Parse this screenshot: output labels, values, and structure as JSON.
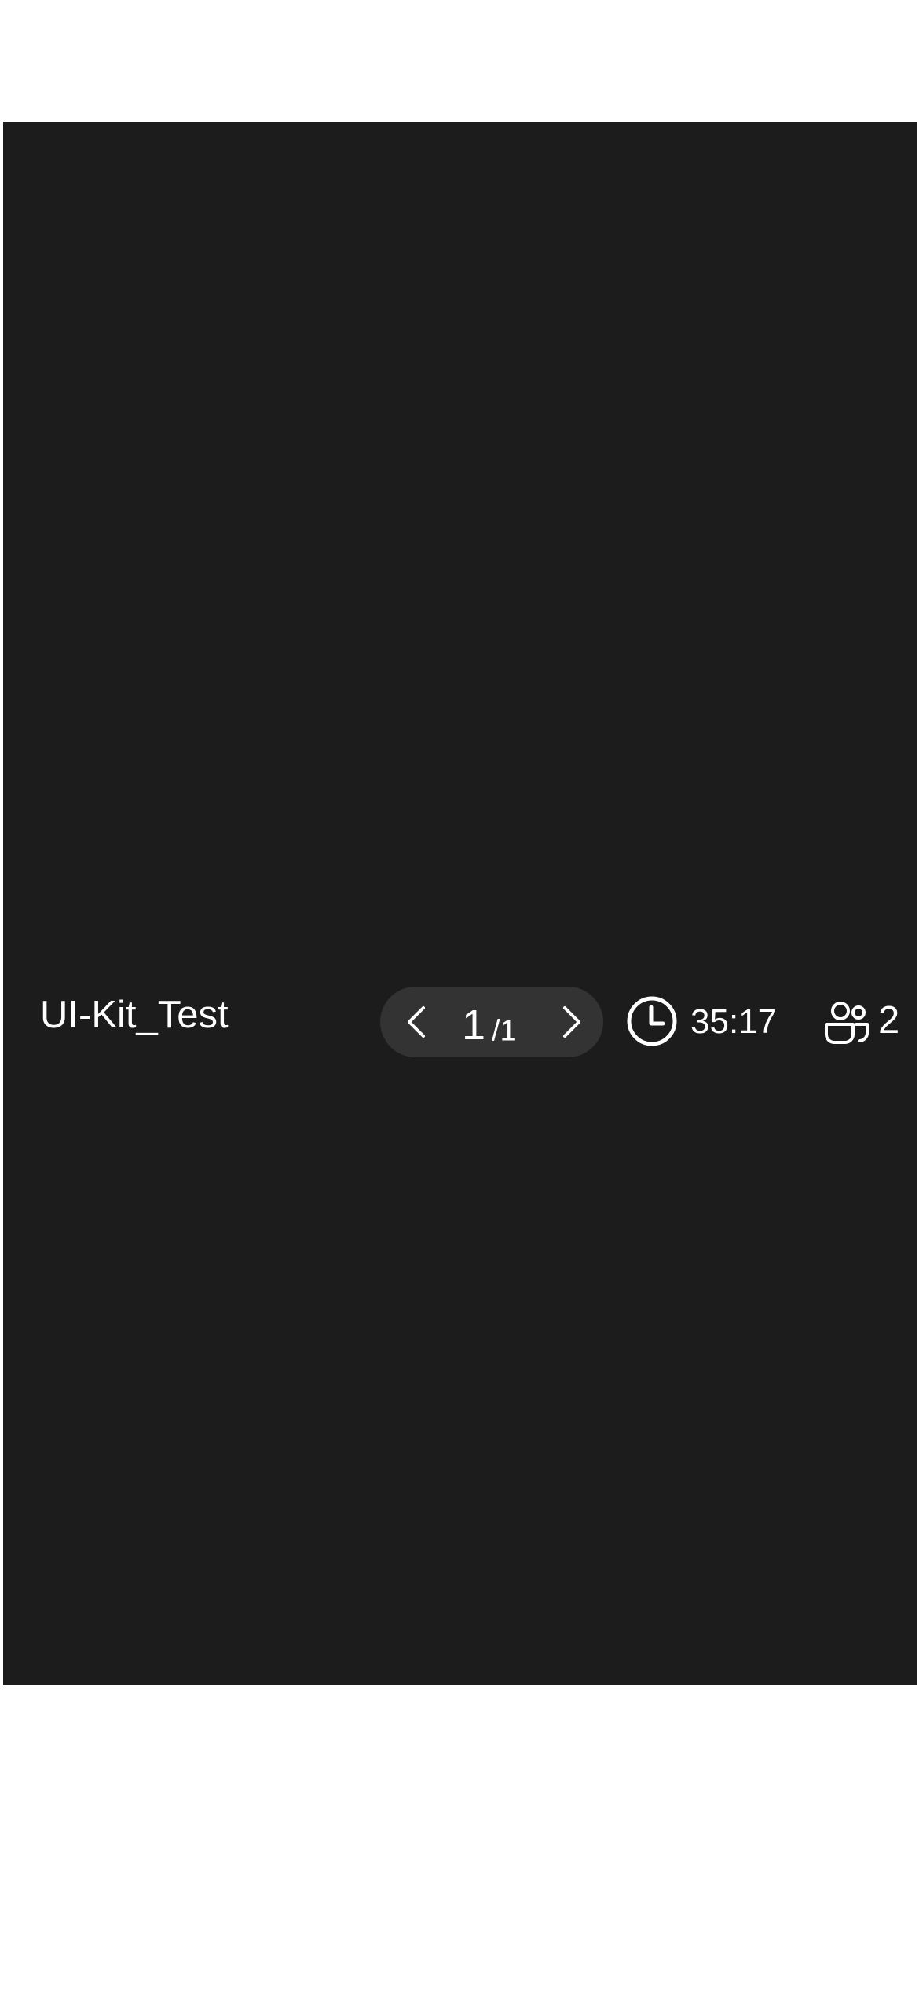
{
  "session": {
    "title": "UI-Kit_Test",
    "timer": "35:17",
    "participant_count": "2"
  },
  "pager": {
    "current_page": "1",
    "total_pages": "/1"
  },
  "icons": {
    "prev": "chevron-left-icon",
    "next": "chevron-right-icon",
    "timer": "clock-icon",
    "participants": "users-icon"
  },
  "colors": {
    "screen_background": "#1c1c1c",
    "pager_background": "#333333",
    "foreground": "#ffffff",
    "page_background": "#ffffff"
  }
}
